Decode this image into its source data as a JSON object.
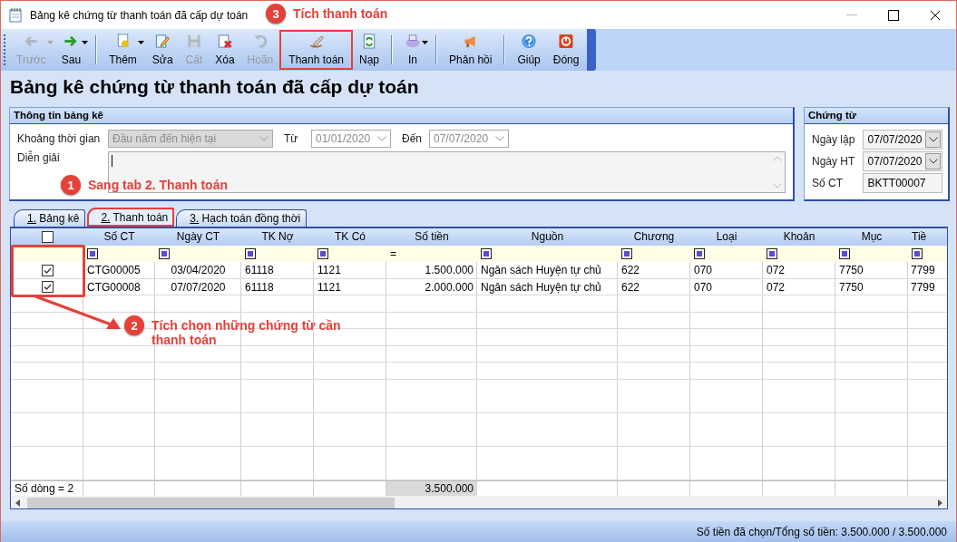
{
  "window": {
    "title": "Bảng kê chứng từ thanh toán đã cấp dự toán"
  },
  "toolbar": [
    {
      "label": "Trước",
      "disabled": true,
      "dropdown": true,
      "highlighted": false
    },
    {
      "label": "Sau",
      "disabled": false,
      "dropdown": true,
      "highlighted": false
    },
    {
      "label": "Thêm",
      "disabled": false,
      "dropdown": true,
      "highlighted": false
    },
    {
      "label": "Sửa",
      "disabled": false,
      "dropdown": false,
      "highlighted": false
    },
    {
      "label": "Cất",
      "disabled": true,
      "dropdown": false,
      "highlighted": false
    },
    {
      "label": "Xóa",
      "disabled": false,
      "dropdown": false,
      "highlighted": false
    },
    {
      "label": "Hoãn",
      "disabled": true,
      "dropdown": false,
      "highlighted": false
    },
    {
      "label": "Thanh toán",
      "disabled": false,
      "dropdown": false,
      "highlighted": true
    },
    {
      "label": "Nạp",
      "disabled": false,
      "dropdown": false,
      "highlighted": false
    },
    {
      "label": "In",
      "disabled": false,
      "dropdown": true,
      "highlighted": false
    },
    {
      "label": "Phản hồi",
      "disabled": false,
      "dropdown": false,
      "highlighted": false
    },
    {
      "label": "Giúp",
      "disabled": false,
      "dropdown": false,
      "highlighted": false
    },
    {
      "label": "Đóng",
      "disabled": false,
      "dropdown": false,
      "highlighted": false
    }
  ],
  "heading": "Bảng kê chứng từ thanh toán đã cấp dự toán",
  "info_group": {
    "title": "Thông tin bảng kê",
    "period": {
      "label": "Khoảng thời gian",
      "value": "Đầu năm đến hiện tại",
      "disabled": true
    },
    "from": {
      "label": "Từ",
      "value": "01/01/2020",
      "disabled": true
    },
    "to": {
      "label": "Đến",
      "value": "07/07/2020",
      "disabled": true
    },
    "description": {
      "label": "Diễn giải"
    }
  },
  "voucher_group": {
    "title": "Chứng từ",
    "fields": [
      {
        "label": "Ngày lập",
        "value": "07/07/2020",
        "kind": "date"
      },
      {
        "label": "Ngày HT",
        "value": "07/07/2020",
        "kind": "date"
      },
      {
        "label": "Số CT",
        "value": "BKTT00007",
        "kind": "text"
      }
    ]
  },
  "tabs": [
    {
      "label": "1. Bảng kê",
      "selected": false,
      "highlighted": false
    },
    {
      "label": "2. Thanh toán",
      "selected": true,
      "highlighted": true
    },
    {
      "label": "3. Hạch toán đồng thời",
      "selected": false,
      "highlighted": false
    }
  ],
  "grid": {
    "header_checked": false,
    "select_column_highlighted": true,
    "columns": [
      {
        "title": "Số CT",
        "kind": "text",
        "filter": {
          "kind": "box"
        }
      },
      {
        "title": "Ngày CT",
        "kind": "date",
        "filter": {
          "kind": "box"
        }
      },
      {
        "title": "TK Nợ",
        "kind": "text",
        "filter": {
          "kind": "box"
        }
      },
      {
        "title": "TK Có",
        "kind": "text",
        "filter": {
          "kind": "box"
        }
      },
      {
        "title": "Số tiền",
        "kind": "money",
        "filter": {
          "kind": "operator",
          "text": "="
        }
      },
      {
        "title": "Nguồn",
        "kind": "text",
        "filter": {
          "kind": "box"
        }
      },
      {
        "title": "Chương",
        "kind": "text",
        "filter": {
          "kind": "box"
        }
      },
      {
        "title": "Loại",
        "kind": "text",
        "filter": {
          "kind": "box"
        }
      },
      {
        "title": "Khoản",
        "kind": "text",
        "filter": {
          "kind": "box"
        }
      },
      {
        "title": "Mục",
        "kind": "text",
        "filter": {
          "kind": "box"
        }
      },
      {
        "title": "Tiề",
        "kind": "text",
        "filter": {
          "kind": "box"
        }
      }
    ],
    "rows": [
      {
        "checked": true,
        "cells": [
          "CTG00005",
          "03/04/2020",
          "61118",
          "1121",
          "1.500.000",
          "Ngân sách Huyện tự chủ",
          "622",
          "070",
          "072",
          "7750",
          "7799"
        ]
      },
      {
        "checked": true,
        "cells": [
          "CTG00008",
          "07/07/2020",
          "61118",
          "1121",
          "2.000.000",
          "Ngân sách Huyện tự chủ",
          "622",
          "070",
          "072",
          "7750",
          "7799"
        ]
      }
    ],
    "footer": {
      "count": "Số dòng = 2",
      "total": "3.500.000"
    }
  },
  "status_bar": "Số tiền đã chọn/Tổng số tiền: 3.500.000 / 3.500.000",
  "annotations": [
    {
      "number": "3",
      "text": "Tích thanh toán"
    },
    {
      "number": "1",
      "text": "Sang tab 2. Thanh toán"
    },
    {
      "number": "2",
      "text": "Tích chọn những chứng từ cần thanh toán"
    }
  ]
}
